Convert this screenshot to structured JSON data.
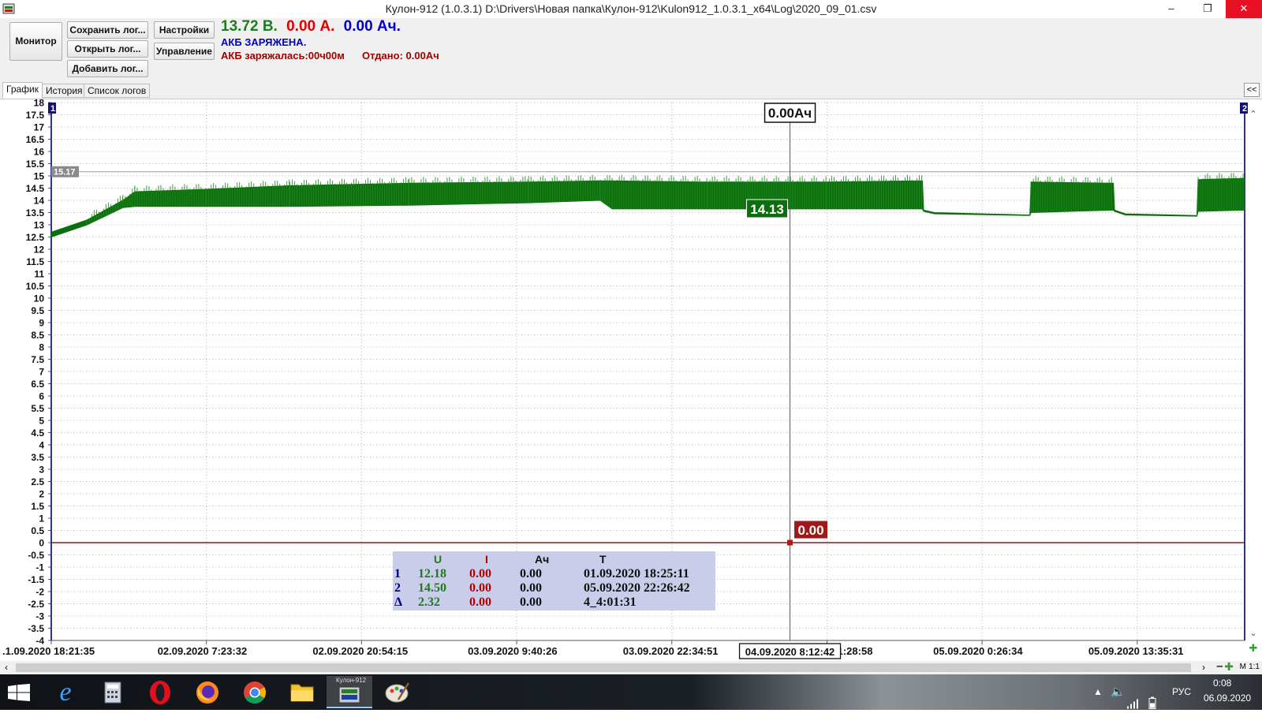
{
  "window": {
    "title": "Кулон-912 (1.0.3.1) D:\\Drivers\\Новая папка\\Кулон-912\\Kulon912_1.0.3.1_x64\\Log\\2020_09_01.csv",
    "controls": {
      "minimize": "–",
      "restore": "❐",
      "close": "✕"
    }
  },
  "toolbar": {
    "monitor": "Монитор",
    "save_log": "Сохранить лог...",
    "open_log": "Открыть лог...",
    "add_log": "Добавить лог...",
    "settings": "Настройки",
    "control": "Управление"
  },
  "status": {
    "voltage": "13.72 В.",
    "current": "0.00 А.",
    "capacity": "0.00 Ач.",
    "state": "АКБ ЗАРЯЖЕНА.",
    "charge_time": "АКБ заряжалась:00ч00м",
    "given": "Отдано: 0.00Ач",
    "colors": {
      "voltage": "#1e7b1e",
      "current": "#e00000",
      "capacity": "#0000cc",
      "state": "#0000cc",
      "info": "#a00000"
    }
  },
  "tabs": [
    "График",
    "История",
    "Список логов"
  ],
  "collapse_label": "<<",
  "chart_data": {
    "type": "line",
    "yticks": [
      "18",
      "17.5",
      "17",
      "16.5",
      "16",
      "15.5",
      "15",
      "14.5",
      "14",
      "13.5",
      "13",
      "12.5",
      "12",
      "11.5",
      "11",
      "10.5",
      "10",
      "9.5",
      "9",
      "8.5",
      "8",
      "7.5",
      "7",
      "6.5",
      "6",
      "5.5",
      "5",
      "4.5",
      "4",
      "3.5",
      "3",
      "2.5",
      "2",
      "1.5",
      "1",
      "0.5",
      "0",
      "-0.5",
      "-1",
      "-1.5",
      "-2",
      "-2.5",
      "-3",
      "-3.5",
      "-4"
    ],
    "ylim": [
      -4,
      18
    ],
    "xticks": [
      ".1.09.2020 18:21:35",
      "02.09.2020 7:23:32",
      "02.09.2020 20:54:15",
      "03.09.2020 9:40:26",
      "03.09.2020 22:34:51",
      "04.09.2020 11:28:58",
      "05.09.2020 0:26:34",
      "05.09.2020 13:35:31"
    ],
    "cursor_time_label": "04.09.2020 8:12:42",
    "cursor_time_fraction": 0.619,
    "cursor_ah_label": "0.00Ач",
    "cursor_voltage_label": "14.13",
    "cursor_current_label": "0.00",
    "ref_line_label": "15.17",
    "ref_line_value": 15.17,
    "marker1": "1",
    "marker2": "2",
    "series": [
      {
        "name": "U",
        "color": "#0d6e0d",
        "envelope": [
          {
            "x": 0.0,
            "low": 12.5,
            "high": 12.7
          },
          {
            "x": 0.03,
            "low": 13.0,
            "high": 13.2
          },
          {
            "x": 0.06,
            "low": 13.7,
            "high": 14.0
          },
          {
            "x": 0.07,
            "low": 13.75,
            "high": 14.35
          },
          {
            "x": 0.13,
            "low": 13.75,
            "high": 14.45
          },
          {
            "x": 0.2,
            "low": 13.75,
            "high": 14.6
          },
          {
            "x": 0.3,
            "low": 13.8,
            "high": 14.7
          },
          {
            "x": 0.4,
            "low": 13.9,
            "high": 14.75
          },
          {
            "x": 0.46,
            "low": 14.0,
            "high": 14.8
          },
          {
            "x": 0.47,
            "low": 13.65,
            "high": 14.8
          },
          {
            "x": 0.55,
            "low": 13.65,
            "high": 14.75
          },
          {
            "x": 0.65,
            "low": 13.65,
            "high": 14.75
          },
          {
            "x": 0.73,
            "low": 13.65,
            "high": 14.8
          },
          {
            "x": 0.731,
            "low": 13.55,
            "high": 13.6
          },
          {
            "x": 0.74,
            "low": 13.45,
            "high": 13.5
          },
          {
            "x": 0.82,
            "low": 13.38,
            "high": 13.4
          },
          {
            "x": 0.821,
            "low": 13.5,
            "high": 14.75
          },
          {
            "x": 0.89,
            "low": 13.6,
            "high": 14.7
          },
          {
            "x": 0.891,
            "low": 13.55,
            "high": 13.6
          },
          {
            "x": 0.9,
            "low": 13.4,
            "high": 13.45
          },
          {
            "x": 0.96,
            "low": 13.35,
            "high": 13.38
          },
          {
            "x": 0.961,
            "low": 13.55,
            "high": 14.85
          },
          {
            "x": 1.0,
            "low": 13.6,
            "high": 14.9
          }
        ]
      }
    ]
  },
  "info_table": {
    "headers": [
      "U",
      "I",
      "Ач",
      "T"
    ],
    "rows": [
      {
        "label": "1",
        "u": "12.18",
        "i": "0.00",
        "ah": "0.00",
        "t": "01.09.2020 18:25:11"
      },
      {
        "label": "2",
        "u": "14.50",
        "i": "0.00",
        "ah": "0.00",
        "t": "05.09.2020 22:26:42"
      },
      {
        "label": "Δ",
        "u": "2.32",
        "i": "0.00",
        "ah": "0.00",
        "t": "4_4:01:31"
      }
    ]
  },
  "scroll_right_labels": {
    "scale": "M",
    "ratio": "1:1"
  },
  "taskbar": {
    "apps": [
      "windows-start-icon",
      "internet-explorer-icon",
      "calculator-icon",
      "opera-icon",
      "firefox-icon",
      "chrome-icon",
      "file-explorer-icon",
      "kulon-912-icon",
      "paint-icon"
    ],
    "active_app_label": "Кулон-912",
    "lang": "РУС",
    "time": "0:08",
    "date": "06.09.2020"
  }
}
